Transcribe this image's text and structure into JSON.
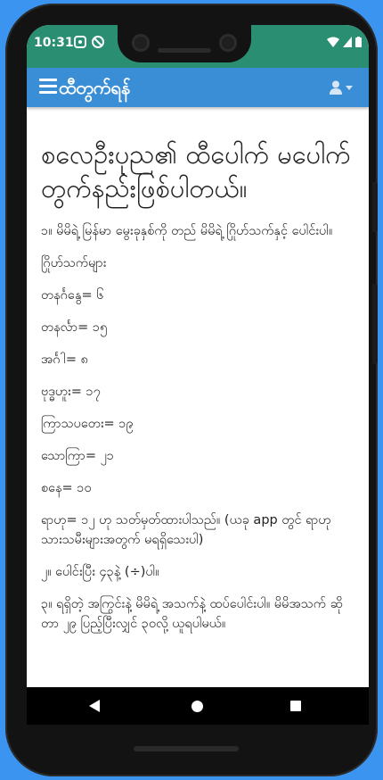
{
  "status_bar": {
    "time": "10:31"
  },
  "app_bar": {
    "title": "ထီတွက်ရန်"
  },
  "article": {
    "heading": "စလေဦးပုည၏ ထီပေါက် မပေါက် တွက်နည်းဖြစ်ပါတယ်။",
    "paragraphs": [
      "၁။ မိမိရဲ့ မြန်မာ မွေးခုနှစ်ကို တည် မိမိရဲ့ ဂြိုဟ်သက်နှင့် ပေါင်းပါ။",
      "ဂြိုဟ်သက်များ",
      "တနင်္ဂနွေ= ၆",
      "တနင်္လာ= ၁၅",
      "အင်္ဂါ= ၈",
      "ဗုဒ္ဓဟူး= ၁၇",
      "ကြာသပတေး= ၁၉",
      "သောကြာ= ၂၁",
      "စနေ= ၁၀",
      "ရာဟု= ၁၂ ဟု သတ်မှတ်ထားပါသည်။ (ယခု app တွင် ရာဟုသားသမီးများအတွက် မရရှိသေးပါ)",
      "၂။ ပေါင်းပြီး ၄၃နဲ့ (÷)ပါ။",
      "၃။ ရရှိတဲ့ အကြွင်းနဲ့ မိမိရဲ့ အသက်နဲ့ ထပ်ပေါင်းပါ။ မိမိအသက် ဆိုတာ ၂၉ ပြည့်ပြီးလျှင် ၃၀လို့ ယူရပါမယ်။"
    ]
  },
  "colors": {
    "status_bar": "#2a8e72",
    "app_bar": "#3a8ed6",
    "background": "#3b95f0"
  },
  "icons": {
    "menu": "hamburger-icon",
    "user": "user-icon",
    "dropdown": "caret-down-icon",
    "wifi": "wifi-icon",
    "battery": "battery-icon",
    "back": "back-triangle-icon",
    "home": "home-circle-icon",
    "recents": "recents-square-icon"
  }
}
